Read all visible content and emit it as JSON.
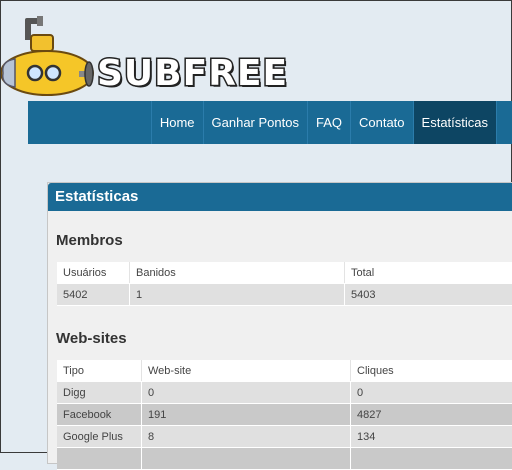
{
  "logo": {
    "text": "SUBFREE"
  },
  "nav": {
    "items": [
      "Home",
      "Ganhar Pontos",
      "FAQ",
      "Contato",
      "Estatísticas"
    ]
  },
  "panel": {
    "title": "Estatísticas"
  },
  "membros": {
    "heading": "Membros",
    "columns": [
      "Usuários",
      "Banidos",
      "Total"
    ],
    "row": [
      "5402",
      "1",
      "5403"
    ]
  },
  "websites": {
    "heading": "Web-sites",
    "columns": [
      "Tipo",
      "Web-site",
      "Cliques"
    ],
    "rows": [
      [
        "Digg",
        "0",
        "0"
      ],
      [
        "Facebook",
        "191",
        "4827"
      ],
      [
        "Google Plus",
        "8",
        "134"
      ]
    ]
  },
  "colors": {
    "accent": "#1a6a95",
    "accent_dark": "#0d4563",
    "background": "#e3ebf2"
  }
}
